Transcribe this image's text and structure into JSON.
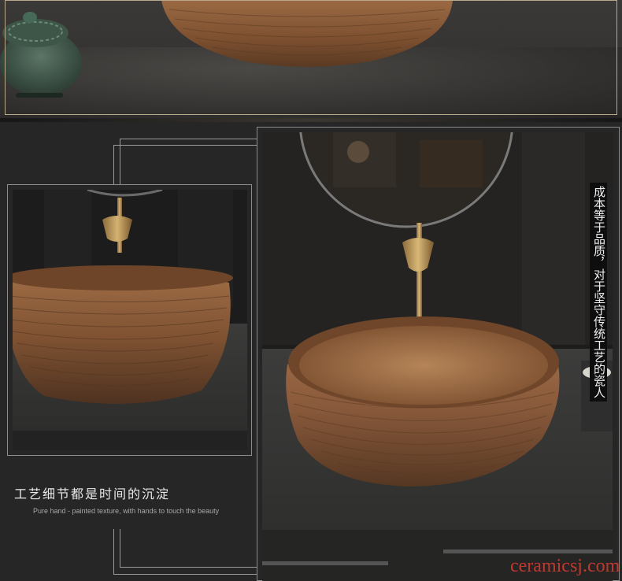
{
  "captions": {
    "title_cn": "工艺细节都是时间的沉淀",
    "subtitle_en": "Pure hand - painted texture, with hands to touch the beauty",
    "side_text": "成本等于品质，对于坚守传统工艺的瓷人"
  },
  "watermark": "ceramicsj.com",
  "colors": {
    "background": "#262626",
    "frame_line": "#9a9a9a",
    "gold_frame": "#b9a98b",
    "bowl_wood": "#8a5a35",
    "watermark": "#c2372e"
  }
}
